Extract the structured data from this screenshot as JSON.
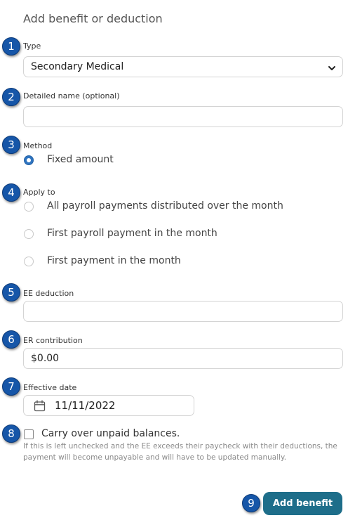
{
  "dialog": {
    "title": "Add benefit or deduction"
  },
  "markers": [
    "1",
    "2",
    "3",
    "4",
    "5",
    "6",
    "7",
    "8",
    "9"
  ],
  "fields": {
    "type": {
      "label": "Type",
      "value": "Secondary Medical"
    },
    "detailed_name": {
      "label": "Detailed name (optional)",
      "value": ""
    },
    "method": {
      "label": "Method",
      "options": [
        "Fixed amount"
      ],
      "selected": "Fixed amount"
    },
    "apply_to": {
      "label": "Apply to",
      "options": [
        "All payroll payments distributed over the month",
        "First payroll payment in the month",
        "First payment in the month"
      ],
      "selected": null
    },
    "ee_deduction": {
      "label": "EE deduction",
      "value": ""
    },
    "er_contribution": {
      "label": "ER contribution",
      "value": "$0.00"
    },
    "effective_date": {
      "label": "Effective date",
      "value": "11/11/2022"
    },
    "carry_over": {
      "label": "Carry over unpaid balances.",
      "checked": false,
      "help": "If this is left unchecked and the EE exceeds their paycheck with their deductions, the payment will become unpayable and will have to be updated manually."
    }
  },
  "actions": {
    "add_label": "Add benefit"
  },
  "colors": {
    "marker": "#1656a8",
    "primary_button": "#1e6e8a",
    "radio_selected": "#2f74c0"
  },
  "icons": {
    "type_dropdown": "chevron-down-icon",
    "effective_date": "calendar-icon"
  }
}
